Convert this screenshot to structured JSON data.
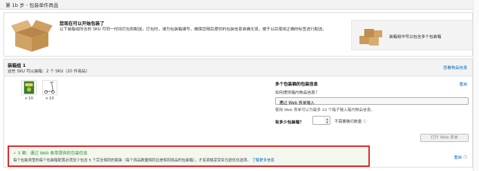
{
  "step_header": {
    "title": "第 1b 步 - 包装单件商品"
  },
  "intro": {
    "title": "您现在可以开始包装了",
    "description": "以下装箱组所含的 SKU 可同一时间打包和配送。打包时，请为包装箱编号，确保您随后提供的包装信息准确无误，便于以后使用正确的标签进行配送。",
    "multi_box_label": "装箱组中可以包含多个包装箱"
  },
  "pack_group": {
    "title": "装箱组 1",
    "subtitle": "这些 SKU 可以装箱：2 个 SKU（20 件商品）",
    "view_info_link": "查看物品信息",
    "products": [
      {
        "name": "product-1",
        "qty": "x 10"
      },
      {
        "name": "product-2",
        "qty": "x 10"
      }
    ]
  },
  "multi_box": {
    "title": "多个包装箱的包装信息",
    "reset": "重启",
    "question": "如何提供箱内物品信息？",
    "select_value": "通过 Web 表单输入",
    "hint": "使用 Web 表单可以为最多 10 个箱子输入箱内物品信息。",
    "boxes_label": "有多少包装箱？",
    "no_count_label": "不需要确切数量",
    "web_form_button": "打开 Web 表单"
  },
  "status": {
    "title": "5 箱：通过 Web 表单提供的包装信息",
    "text": "每个包装类型的每个包装箱配置必须至少包含 5 个完全相同的套装（每个商品数量相同且是相同商品的包装箱），才有资格享受亚马逊优化选项。",
    "link": "了解更多信息",
    "reset": "重启"
  },
  "colors": {
    "link": "#0066c0",
    "success": "#2f8a2f",
    "highlight_border": "#e02020"
  }
}
